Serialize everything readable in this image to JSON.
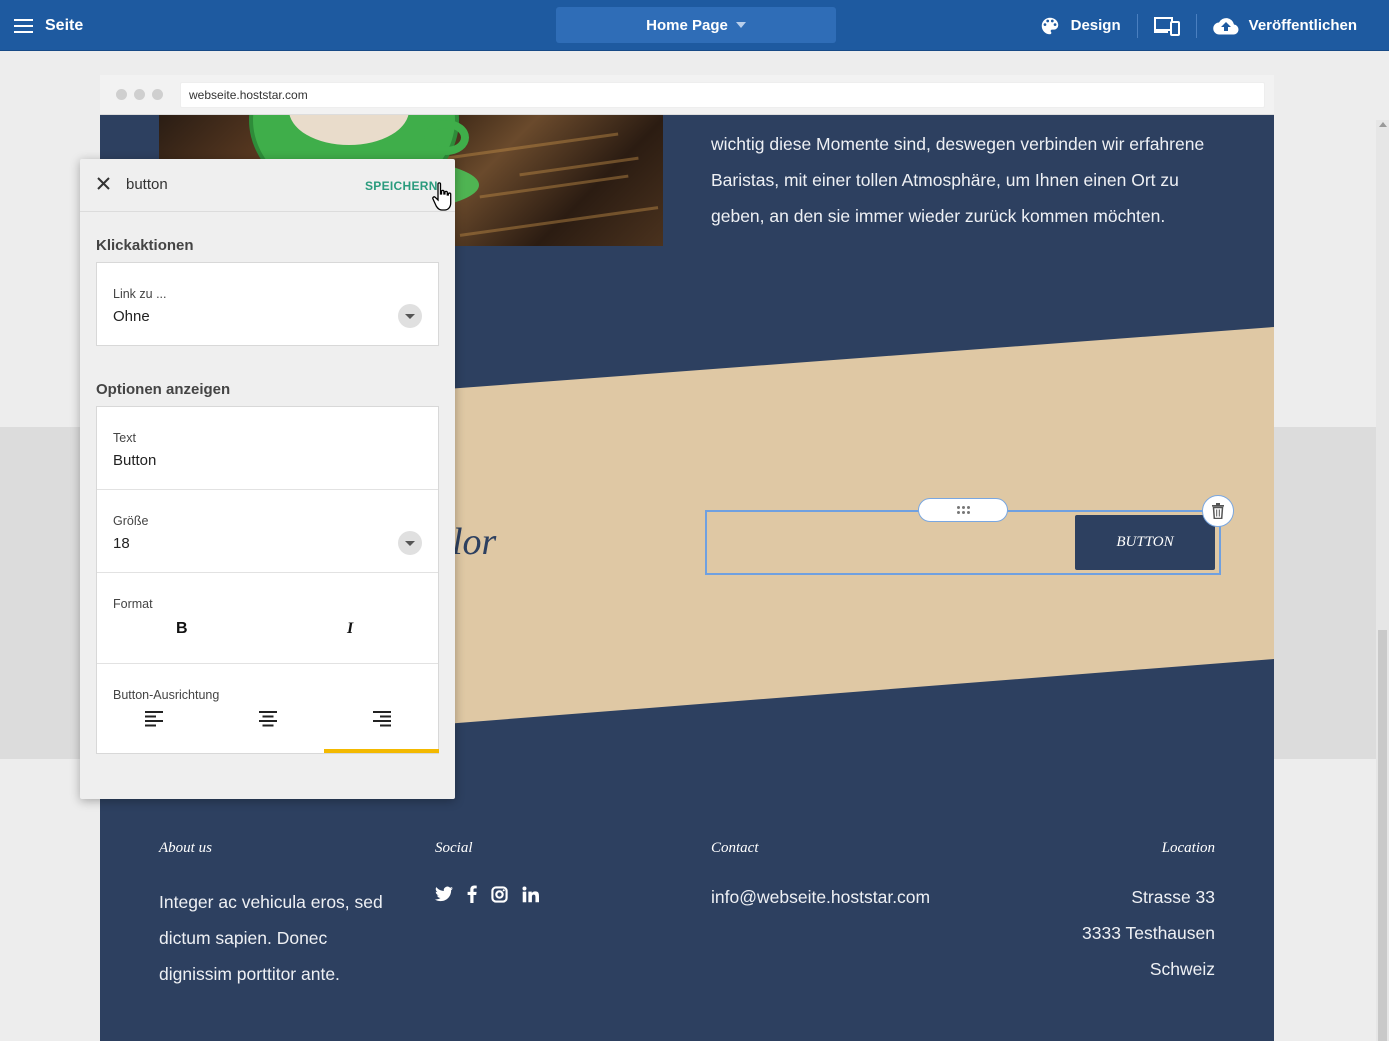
{
  "topbar": {
    "menu_label": "Seite",
    "page_select": "Home Page",
    "design_label": "Design",
    "publish_label": "Veröffentlichen"
  },
  "browser": {
    "url": "webseite.hoststar.com"
  },
  "site": {
    "intro_lines": [
      "wichtig diese Momente sind, deswegen verbinden wir erfahrene",
      "Baristas, mit einer tollen Atmosphäre, um Ihnen einen Ort zu",
      "geben, an den sie immer wieder zurück kommen möchten."
    ],
    "lorem_fragment": "lor",
    "button_text": "BUTTON",
    "footer": {
      "about_title": "About us",
      "about_lines": [
        "Integer ac vehicula eros, sed",
        "dictum sapien. Donec",
        "dignissim porttitor ante."
      ],
      "social_title": "Social",
      "social_icons": [
        "twitter-icon",
        "facebook-icon",
        "instagram-icon",
        "linkedin-icon"
      ],
      "contact_title": "Contact",
      "contact_email": "info@webseite.hoststar.com",
      "location_title": "Location",
      "location_lines": [
        "Strasse 33",
        "3333 Testhausen",
        "Schweiz"
      ]
    }
  },
  "panel": {
    "title": "button",
    "save_label": "SPEICHERN",
    "click_section": "Klickaktionen",
    "link_label": "Link zu ...",
    "link_value": "Ohne",
    "display_section": "Optionen anzeigen",
    "text_label": "Text",
    "text_value": "Button",
    "size_label": "Größe",
    "size_value": "18",
    "format_label": "Format",
    "bold_glyph": "B",
    "italic_glyph": "I",
    "align_label": "Button-Ausrichtung",
    "align_options": [
      "left",
      "center",
      "right"
    ],
    "align_selected": "right"
  },
  "colors": {
    "topbar": "#1e5aa0",
    "site_navy": "#2d4060",
    "site_beige": "#dfc8a4",
    "save_green": "#2a9b7d",
    "selected_indicator": "#f3b900",
    "selection_outline": "#6fa0e0"
  }
}
